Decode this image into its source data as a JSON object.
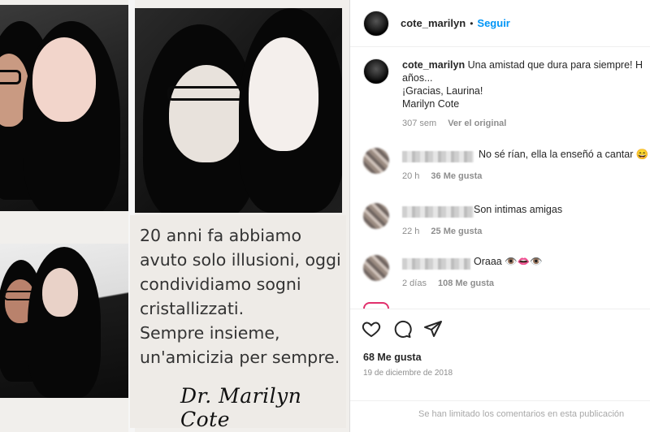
{
  "post": {
    "caption_image_text": [
      "20 anni fa abbiamo",
      "avuto solo illusioni, oggi",
      "condividiamo sogni",
      "cristallizzati.",
      "Sempre insieme,",
      "un'amicizia per sempre."
    ],
    "signature": "Dr. Marilyn Cote"
  },
  "header": {
    "username": "cote_marilyn",
    "separator": "•",
    "follow_label": "Seguir"
  },
  "caption": {
    "username": "cote_marilyn",
    "line1": "Una amistad que dura para siempre! H",
    "line2": "años...",
    "line3": "¡Gracias, Laurina!",
    "line4": "Marilyn Cote",
    "time": "307 sem",
    "see_original": "Ver el original"
  },
  "comments": [
    {
      "text": "No sé rían, ella la enseñó a cantar 😄",
      "time": "20 h",
      "likes": "36 Me gusta"
    },
    {
      "text": "Son intimas amigas",
      "time": "22 h",
      "likes": "25 Me gusta"
    },
    {
      "text": "Oraaa 👁️👄👁️",
      "time": "2 días",
      "likes": "108 Me gusta"
    }
  ],
  "actions": {
    "likes": "68 Me gusta",
    "date": "19 de diciembre de 2018",
    "comments_limited": "Se han limitado los comentarios en esta publicación"
  },
  "icons": [
    "heart-icon",
    "comment-icon",
    "share-icon"
  ],
  "colors": {
    "follow": "#0095f6",
    "meta": "#8e8e8e",
    "text": "#262626"
  }
}
